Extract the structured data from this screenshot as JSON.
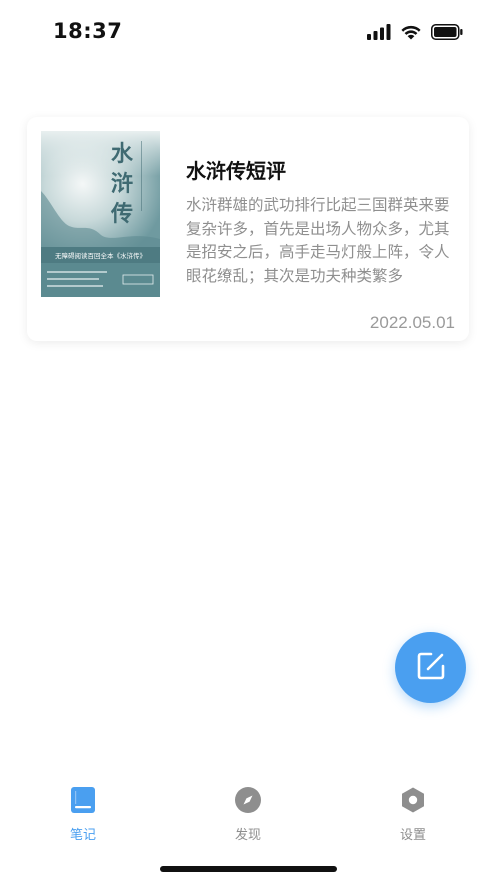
{
  "status_bar": {
    "time": "18:37",
    "icons": [
      "signal-icon",
      "wifi-icon",
      "battery-icon"
    ]
  },
  "notes": [
    {
      "title": "水浒传短评",
      "excerpt": "水浒群雄的武功排行比起三国群英来要复杂许多，首先是出场人物众多，尤其是招安之后，高手走马灯般上阵，令人眼花缭乱；其次是功夫种类繁多",
      "date": "2022.05.01",
      "cover": {
        "title": "水浒传",
        "banner": "无障碍阅读百回全本《水浒传》",
        "colors": {
          "main": "#5b8a90",
          "band": "#4e7b82",
          "top": "#e9f0f0"
        }
      }
    }
  ],
  "fab": {
    "icon": "edit-icon"
  },
  "tabs": [
    {
      "label": "笔记",
      "icon": "notebook-icon",
      "active": true
    },
    {
      "label": "发现",
      "icon": "compass-icon",
      "active": false
    },
    {
      "label": "设置",
      "icon": "settings-icon",
      "active": false
    }
  ],
  "colors": {
    "accent": "#4a9ff0",
    "inactive": "#8e8e8e",
    "excerpt": "#8f8f8f"
  }
}
